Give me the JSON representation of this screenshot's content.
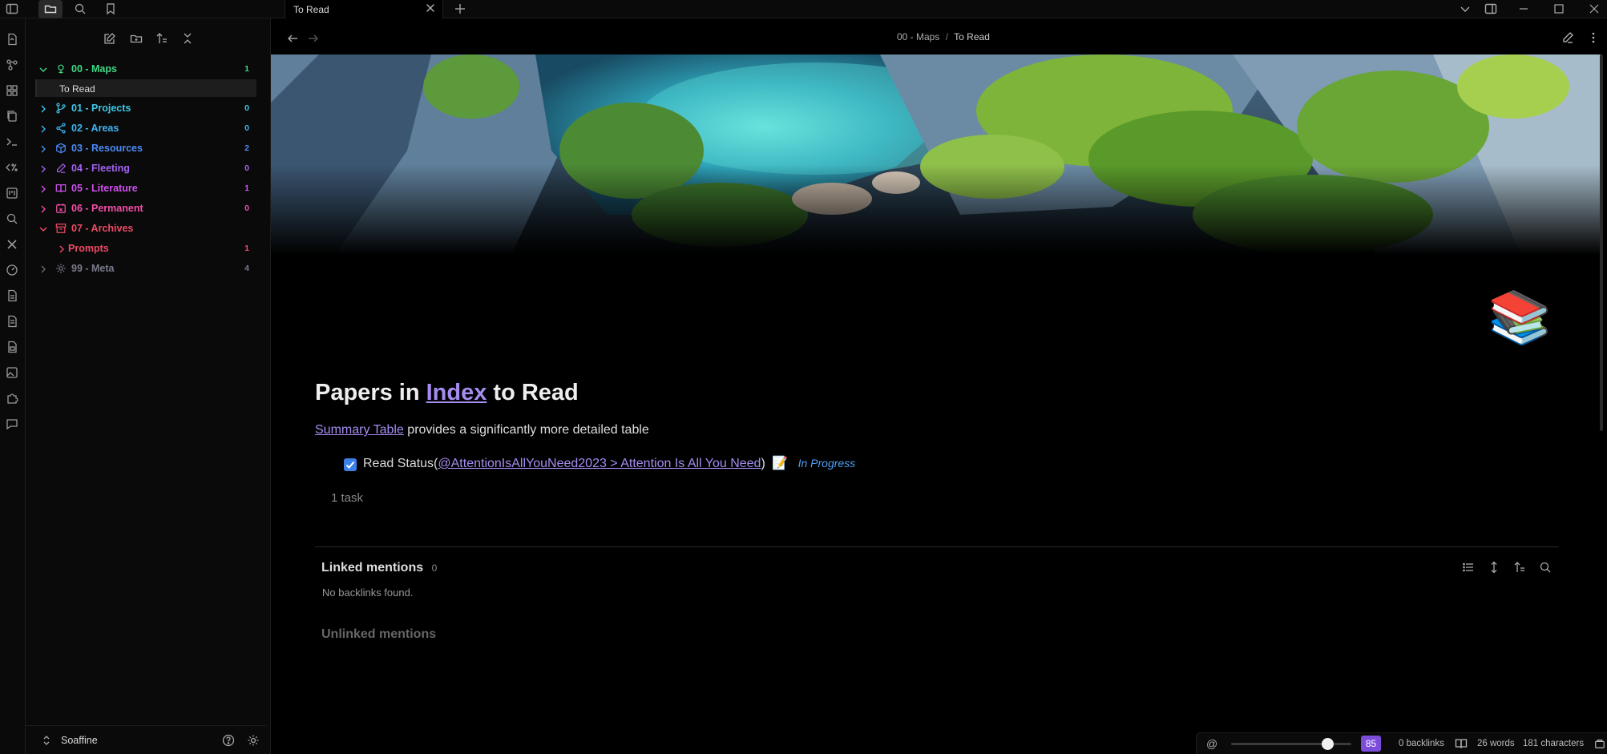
{
  "tabs": [
    {
      "title": "To Read"
    }
  ],
  "breadcrumb": {
    "folder": "00 - Maps",
    "separator": "/",
    "note": "To Read"
  },
  "sidebar": {
    "vault_name": "Soaffine",
    "items": [
      {
        "label": "00 - Maps",
        "count": "1",
        "color": "#3fd984",
        "expanded": true,
        "icon": "map-pin-icon"
      },
      {
        "label": "To Read",
        "selected": true
      },
      {
        "label": "01 - Projects",
        "count": "0",
        "color": "#3fc7e8",
        "icon": "git-branch-icon"
      },
      {
        "label": "02 - Areas",
        "count": "0",
        "color": "#3fb4f0",
        "icon": "share-icon"
      },
      {
        "label": "03 - Resources",
        "count": "2",
        "color": "#4c8bf5",
        "icon": "box-icon"
      },
      {
        "label": "04 - Fleeting",
        "count": "0",
        "color": "#a463f2",
        "icon": "pencil-icon"
      },
      {
        "label": "05 - Literature",
        "count": "1",
        "color": "#d14ff0",
        "icon": "book-icon"
      },
      {
        "label": "06 - Permanent",
        "count": "0",
        "color": "#f04fa8",
        "icon": "calendar-x-icon"
      },
      {
        "label": "07 - Archives",
        "count": "",
        "color": "#f04a66",
        "expanded": true,
        "icon": "archive-icon"
      },
      {
        "label": "Prompts",
        "count": "1",
        "color": "#f04a66"
      },
      {
        "label": "99 - Meta",
        "count": "4",
        "color": "#7a7a8a",
        "icon": "gear-icon"
      }
    ]
  },
  "note": {
    "heading_prefix": "Papers in ",
    "heading_link": "Index",
    "heading_suffix": " to Read",
    "para_link": "Summary Table",
    "para_text": " provides a significantly more detailed table",
    "task_prefix": "Read Status(",
    "task_link": "@AttentionIsAllYouNeed2023 > Attention Is All You Need",
    "task_suffix": ")",
    "task_emoji": "📝",
    "task_status": "In Progress",
    "task_count": "1 task",
    "icon_emoji": "📚"
  },
  "backlinks": {
    "linked_title": "Linked mentions",
    "linked_count": "0",
    "no_backlinks": "No backlinks found.",
    "unlinked_title": "Unlinked mentions"
  },
  "statusbar": {
    "at_symbol": "@",
    "badge": "85",
    "backlinks": "0 backlinks",
    "words": "26 words",
    "chars": "181 characters"
  },
  "colors": {
    "accent": "#a58cf0",
    "status": "#4ea1f3",
    "badge": "#7c4ddb"
  }
}
